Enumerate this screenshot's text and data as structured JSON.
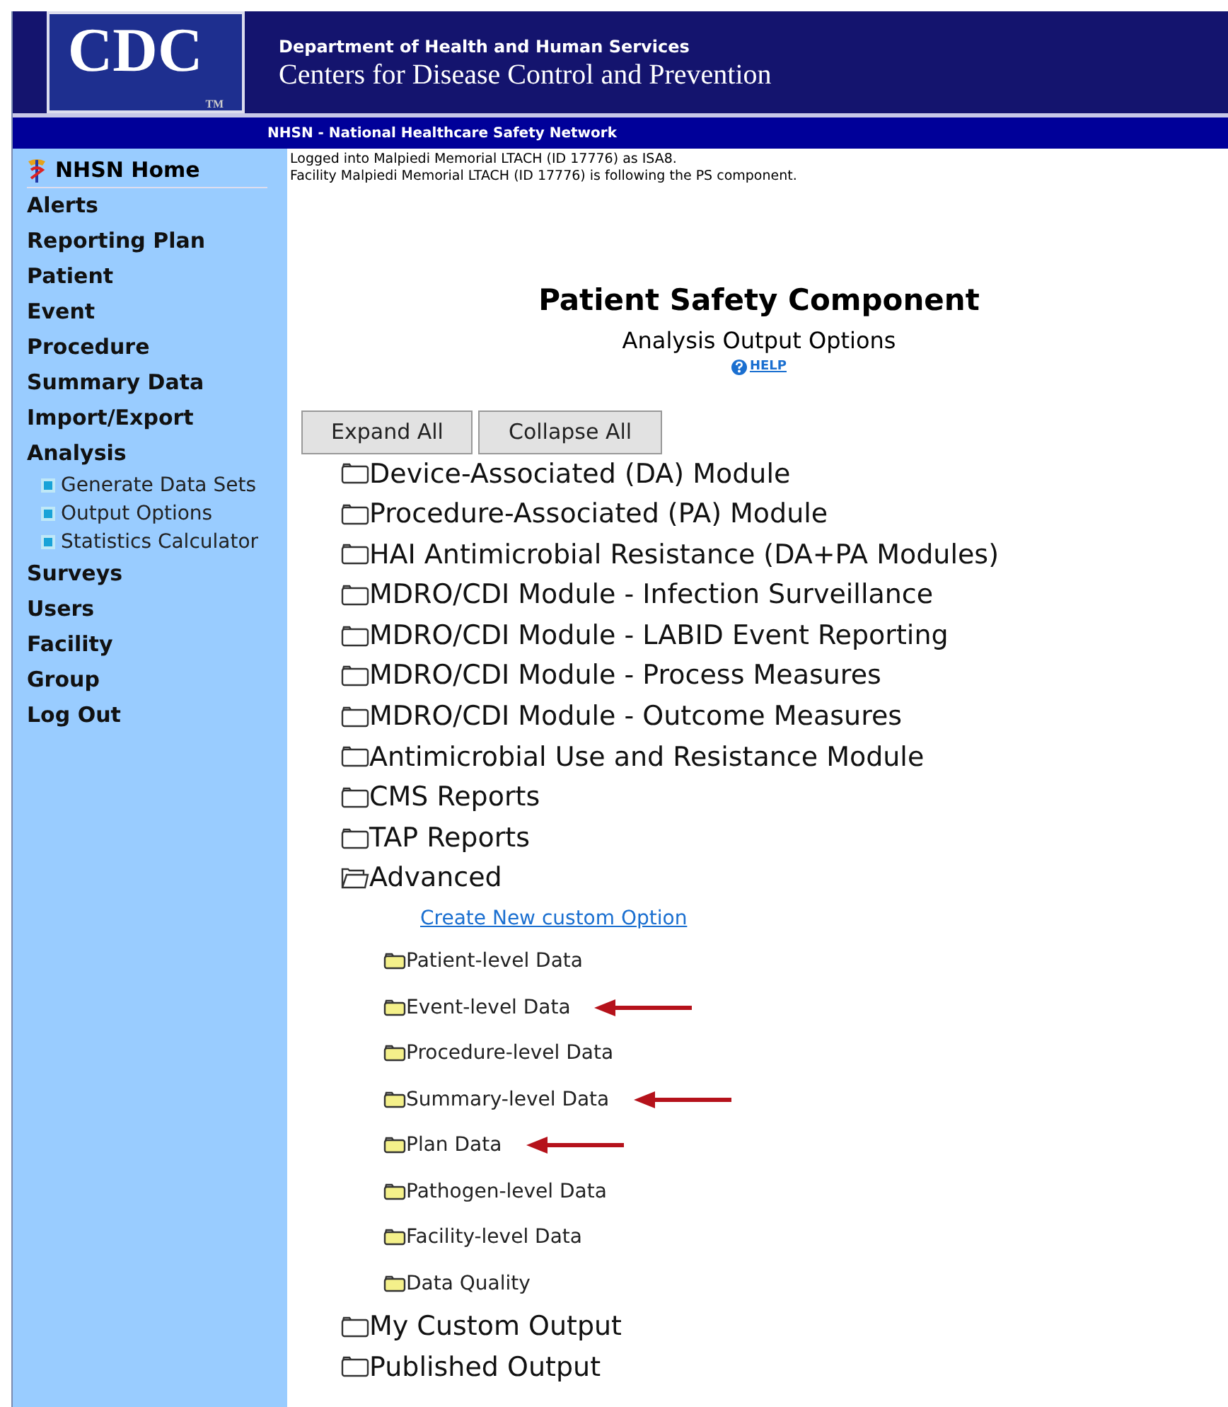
{
  "header": {
    "logo": "CDC",
    "trademark": "TM",
    "department": "Department of Health and Human Services",
    "agency": "Centers for Disease Control and Prevention"
  },
  "banner": "NHSN - National Healthcare Safety Network",
  "sidebar": {
    "items": [
      {
        "label": "NHSN Home",
        "kind": "home"
      },
      {
        "label": "Alerts",
        "kind": "section"
      },
      {
        "label": "Reporting Plan",
        "kind": "section"
      },
      {
        "label": "Patient",
        "kind": "section"
      },
      {
        "label": "Event",
        "kind": "section"
      },
      {
        "label": "Procedure",
        "kind": "section"
      },
      {
        "label": "Summary Data",
        "kind": "section"
      },
      {
        "label": "Import/Export",
        "kind": "section"
      },
      {
        "label": "Analysis",
        "kind": "section"
      },
      {
        "label": "Generate Data Sets",
        "kind": "sub"
      },
      {
        "label": "Output Options",
        "kind": "sub"
      },
      {
        "label": "Statistics Calculator",
        "kind": "sub"
      },
      {
        "label": "Surveys",
        "kind": "section"
      },
      {
        "label": "Users",
        "kind": "section"
      },
      {
        "label": "Facility",
        "kind": "section"
      },
      {
        "label": "Group",
        "kind": "section"
      },
      {
        "label": "Log Out",
        "kind": "section"
      }
    ]
  },
  "login_info": [
    "Logged into Malpiedi Memorial LTACH (ID 17776) as ISA8.",
    "Facility Malpiedi Memorial LTACH (ID 17776) is following the PS component."
  ],
  "page_title": "Patient Safety Component",
  "page_subtitle": "Analysis Output Options",
  "help": "HELP",
  "buttons": [
    "Expand All",
    "Collapse All"
  ],
  "tree": [
    {
      "label": "Device-Associated (DA) Module",
      "expanded": false
    },
    {
      "label": "Procedure-Associated (PA) Module",
      "expanded": false
    },
    {
      "label": "HAI Antimicrobial Resistance (DA+PA Modules)",
      "expanded": false
    },
    {
      "label": "MDRO/CDI Module - Infection Surveillance",
      "expanded": false
    },
    {
      "label": "MDRO/CDI Module - LABID Event Reporting",
      "expanded": false
    },
    {
      "label": "MDRO/CDI Module - Process Measures",
      "expanded": false
    },
    {
      "label": "MDRO/CDI Module - Outcome Measures",
      "expanded": false
    },
    {
      "label": "Antimicrobial Use and Resistance Module",
      "expanded": false
    },
    {
      "label": "CMS Reports",
      "expanded": false
    },
    {
      "label": "TAP Reports",
      "expanded": false
    },
    {
      "label": "Advanced",
      "expanded": true,
      "children": [
        {
          "label": "Create New custom Option",
          "kind": "link",
          "pointed": false
        },
        {
          "label": "Patient-level Data",
          "kind": "folder",
          "pointed": false
        },
        {
          "label": "Event-level Data",
          "kind": "folder",
          "pointed": true
        },
        {
          "label": "Procedure-level Data",
          "kind": "folder",
          "pointed": false
        },
        {
          "label": "Summary-level Data",
          "kind": "folder",
          "pointed": true
        },
        {
          "label": "Plan Data",
          "kind": "folder",
          "pointed": true
        },
        {
          "label": "Pathogen-level Data",
          "kind": "folder",
          "pointed": false
        },
        {
          "label": "Facility-level Data",
          "kind": "folder",
          "pointed": false
        },
        {
          "label": "Data Quality",
          "kind": "folder",
          "pointed": false
        }
      ]
    },
    {
      "label": "My Custom Output",
      "expanded": false
    },
    {
      "label": "Published Output",
      "expanded": false
    }
  ]
}
